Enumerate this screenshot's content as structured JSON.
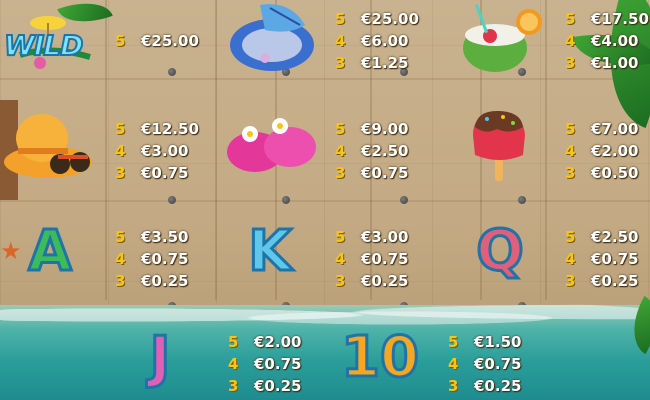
{
  "symbols": [
    {
      "name": "wild",
      "label": "WILD",
      "payouts": [
        {
          "count": "5",
          "amount": "€25.00"
        }
      ]
    },
    {
      "name": "shell",
      "payouts": [
        {
          "count": "5",
          "amount": "€25.00"
        },
        {
          "count": "4",
          "amount": "€6.00"
        },
        {
          "count": "3",
          "amount": "€1.25"
        }
      ]
    },
    {
      "name": "coconut-drink",
      "payouts": [
        {
          "count": "5",
          "amount": "€17.50"
        },
        {
          "count": "4",
          "amount": "€4.00"
        },
        {
          "count": "3",
          "amount": "€1.00"
        }
      ]
    },
    {
      "name": "sun-hat",
      "payouts": [
        {
          "count": "5",
          "amount": "€12.50"
        },
        {
          "count": "4",
          "amount": "€3.00"
        },
        {
          "count": "3",
          "amount": "€0.75"
        }
      ]
    },
    {
      "name": "flip-flops",
      "payouts": [
        {
          "count": "5",
          "amount": "€9.00"
        },
        {
          "count": "4",
          "amount": "€2.50"
        },
        {
          "count": "3",
          "amount": "€0.75"
        }
      ]
    },
    {
      "name": "ice-cream",
      "payouts": [
        {
          "count": "5",
          "amount": "€7.00"
        },
        {
          "count": "4",
          "amount": "€2.00"
        },
        {
          "count": "3",
          "amount": "€0.50"
        }
      ]
    },
    {
      "name": "letter-a",
      "label": "A",
      "payouts": [
        {
          "count": "5",
          "amount": "€3.50"
        },
        {
          "count": "4",
          "amount": "€0.75"
        },
        {
          "count": "3",
          "amount": "€0.25"
        }
      ]
    },
    {
      "name": "letter-k",
      "label": "K",
      "payouts": [
        {
          "count": "5",
          "amount": "€3.00"
        },
        {
          "count": "4",
          "amount": "€0.75"
        },
        {
          "count": "3",
          "amount": "€0.25"
        }
      ]
    },
    {
      "name": "letter-q",
      "label": "Q",
      "payouts": [
        {
          "count": "5",
          "amount": "€2.50"
        },
        {
          "count": "4",
          "amount": "€0.75"
        },
        {
          "count": "3",
          "amount": "€0.25"
        }
      ]
    },
    {
      "name": "letter-j",
      "label": "J",
      "payouts": [
        {
          "count": "5",
          "amount": "€2.00"
        },
        {
          "count": "4",
          "amount": "€0.75"
        },
        {
          "count": "3",
          "amount": "€0.25"
        }
      ]
    },
    {
      "name": "number-10",
      "label": "10",
      "payouts": [
        {
          "count": "5",
          "amount": "€1.50"
        },
        {
          "count": "4",
          "amount": "€0.75"
        },
        {
          "count": "3",
          "amount": "€0.25"
        }
      ]
    }
  ],
  "colors": {
    "count": "#f5c518",
    "amount": "#ffffff",
    "letter_a": "#3dbb5a",
    "letter_k": "#5fc7e8",
    "letter_q": "#e0607a",
    "letter_j": "#e060b4",
    "number_10": "#f5a623"
  }
}
